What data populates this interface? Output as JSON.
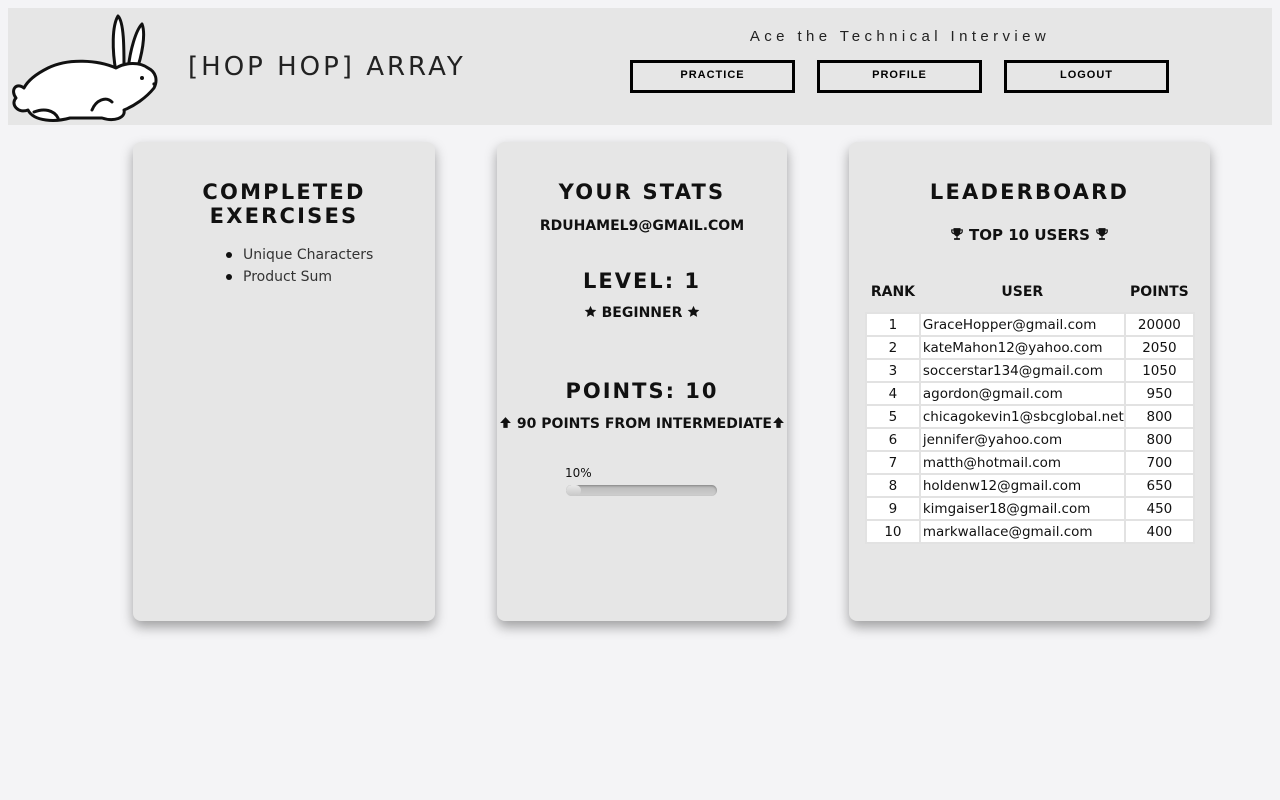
{
  "header": {
    "brand": "[HOP HOP] ARRAY",
    "tagline": "Ace the Technical Interview",
    "nav": {
      "practice": "PRACTICE",
      "profile": "PROFILE",
      "logout": "LOGOUT"
    }
  },
  "exercises": {
    "title": "COMPLETED EXERCISES",
    "items": [
      "Unique Characters",
      "Product Sum"
    ]
  },
  "stats": {
    "title": "YOUR STATS",
    "email": "RDUHAMEL9@GMAIL.COM",
    "level": "LEVEL: 1",
    "rank": "BEGINNER",
    "points": "POINTS: 10",
    "next": "90 POINTS FROM INTERMEDIATE",
    "progress_label": "10%",
    "progress_fraction": 0.1
  },
  "leaderboard": {
    "title": "LEADERBOARD",
    "subtitle": "TOP 10 USERS",
    "columns": [
      "RANK",
      "USER",
      "POINTS"
    ],
    "rows": [
      [
        "1",
        "GraceHopper@gmail.com",
        "20000"
      ],
      [
        "2",
        "kateMahon12@yahoo.com",
        "2050"
      ],
      [
        "3",
        "soccerstar134@gmail.com",
        "1050"
      ],
      [
        "4",
        "agordon@gmail.com",
        "950"
      ],
      [
        "5",
        "chicagokevin1@sbcglobal.net",
        "800"
      ],
      [
        "6",
        "jennifer@yahoo.com",
        "800"
      ],
      [
        "7",
        "matth@hotmail.com",
        "700"
      ],
      [
        "8",
        "holdenw12@gmail.com",
        "650"
      ],
      [
        "9",
        "kimgaiser18@gmail.com",
        "450"
      ],
      [
        "10",
        "markwallace@gmail.com",
        "400"
      ]
    ]
  },
  "icons": {
    "logo": "rabbit-logo-icon",
    "rank": "star-icon",
    "next": "arrow-up-icon",
    "leaderboard": "trophy-icon"
  }
}
